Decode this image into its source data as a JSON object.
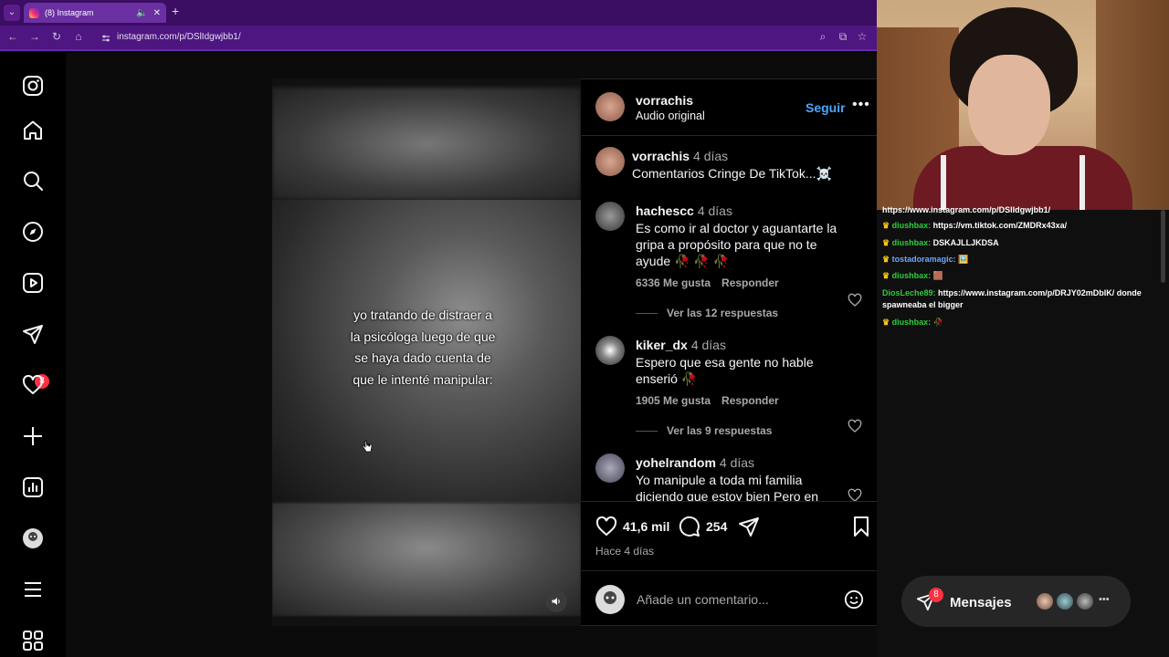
{
  "browser": {
    "tab_title": "(8) Instagram",
    "url": "instagram.com/p/DSlIdgwjbb1/"
  },
  "sidebar": {
    "notifications_badge": "8"
  },
  "post": {
    "video_caption": "yo tratando de distraer a\nla psicóloga luego de que\nse haya dado cuenta de\nque le intenté manipular:",
    "author": "vorrachis",
    "audio": "Audio original",
    "follow_label": "Seguir",
    "likes": "41,6 mil",
    "comments_count": "254",
    "posted": "Hace 4 días",
    "add_comment_placeholder": "Añade un comentario..."
  },
  "comments": [
    {
      "user": "vorrachis",
      "time": "4 días",
      "text": "Comentarios Cringe De TikTok...☠️"
    },
    {
      "user": "hachescc",
      "time": "4 días",
      "text": "Es como ir al doctor y aguantarte la gripa a propósito para que no te ayude 🥀 🥀 🥀",
      "likes": "6336 Me gusta",
      "reply": "Responder",
      "replies": "Ver las 12 respuestas"
    },
    {
      "user": "kiker_dx",
      "time": "4 días",
      "text": "Espero que esa gente no hable enserió 🥀",
      "likes": "1905 Me gusta",
      "reply": "Responder",
      "replies": "Ver las 9 respuestas"
    },
    {
      "user": "yohelrandom",
      "time": "4 días",
      "text": "Yo manipule a toda mi familia diciendo que estoy bien Pero en"
    }
  ],
  "chat": [
    {
      "user": "",
      "msg": "https://www.instagram.com/p/DSlIdgwjbb1/"
    },
    {
      "user": "diushbax:",
      "msg": "https://vm.tiktok.com/ZMDRx43xa/"
    },
    {
      "user": "diushbax:",
      "msg": "DSKAJLLJKDSA"
    },
    {
      "user": "tostadoramagic:",
      "msg": "🖼️"
    },
    {
      "user": "diushbax:",
      "msg": "🟫"
    },
    {
      "user": "DiosLeche89:",
      "msg": "https://www.instagram.com/p/DRJY02mDblK/ donde spawneaba el bigger"
    },
    {
      "user": "diushbax:",
      "msg": "🥀"
    }
  ],
  "messages": {
    "label": "Mensajes",
    "badge": "8"
  },
  "colors": {
    "accent_blue": "#4ca5ff",
    "badge_red": "#ff3040",
    "browser_purple": "#4d1680"
  }
}
